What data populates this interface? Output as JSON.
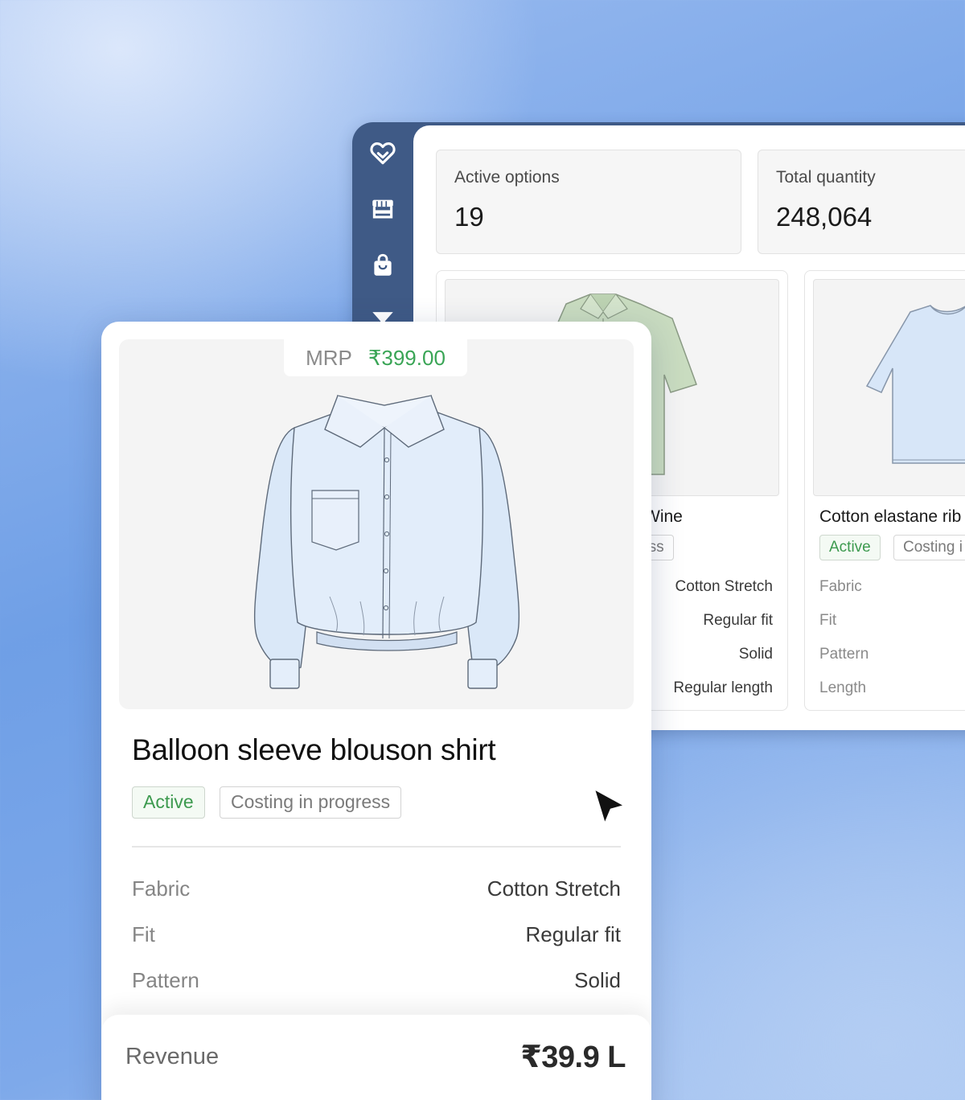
{
  "sidebar": {
    "icons": [
      "logo-heart-icon",
      "storefront-icon",
      "shopping-bag-icon",
      "filter-icon"
    ]
  },
  "stats": [
    {
      "label": "Active options",
      "value": "19"
    },
    {
      "label": "Total quantity",
      "value": "248,064"
    }
  ],
  "back_cards": [
    {
      "title": "Wine",
      "tag_visible": "ess",
      "specs": [
        {
          "value": "Cotton Stretch"
        },
        {
          "value": "Regular fit"
        },
        {
          "value": "Solid"
        },
        {
          "value": "Regular length"
        }
      ]
    },
    {
      "title": "Cotton elastane rib",
      "tags": [
        "Active",
        "Costing i"
      ],
      "specs": [
        {
          "label": "Fabric"
        },
        {
          "label": "Fit"
        },
        {
          "label": "Pattern"
        },
        {
          "label": "Length"
        }
      ]
    }
  ],
  "front_card": {
    "mrp_label": "MRP",
    "mrp_value": "₹399.00",
    "title": "Balloon sleeve blouson shirt",
    "tags": [
      "Active",
      "Costing in progress"
    ],
    "specs": [
      {
        "label": "Fabric",
        "value": "Cotton Stretch"
      },
      {
        "label": "Fit",
        "value": "Regular fit"
      },
      {
        "label": "Pattern",
        "value": "Solid"
      }
    ],
    "revenue_label": "Revenue",
    "revenue_value": "₹39.9 L"
  },
  "colors": {
    "sidebar": "#3f5a86",
    "active_green": "#3d9a4f",
    "price_green": "#3aa556"
  }
}
